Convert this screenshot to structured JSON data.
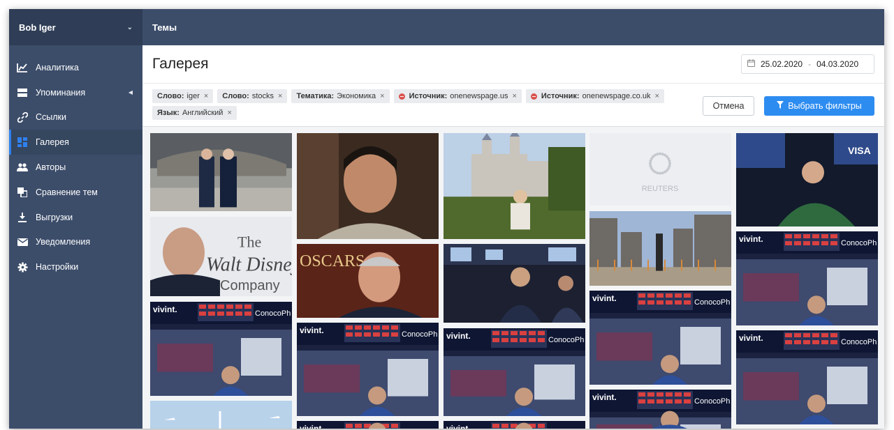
{
  "sidebar": {
    "user_name": "Bob Iger",
    "items": [
      {
        "label": "Аналитика",
        "icon": "chart-icon"
      },
      {
        "label": "Упоминания",
        "icon": "mentions-icon"
      },
      {
        "label": "Ссылки",
        "icon": "link-icon"
      },
      {
        "label": "Галерея",
        "icon": "gallery-icon"
      },
      {
        "label": "Авторы",
        "icon": "authors-icon"
      },
      {
        "label": "Сравнение тем",
        "icon": "compare-icon"
      },
      {
        "label": "Выгрузки",
        "icon": "download-icon"
      },
      {
        "label": "Уведомления",
        "icon": "mail-icon"
      },
      {
        "label": "Настройки",
        "icon": "gear-icon"
      }
    ],
    "active_index": 3
  },
  "topbar": {
    "title": "Темы"
  },
  "header": {
    "title": "Галерея",
    "date_from": "25.02.2020",
    "date_sep": "-",
    "date_to": "04.03.2020"
  },
  "filters": {
    "chips": [
      {
        "key": "Слово:",
        "value": "iger",
        "excluded": false
      },
      {
        "key": "Слово:",
        "value": "stocks",
        "excluded": false
      },
      {
        "key": "Тематика:",
        "value": "Экономика",
        "excluded": false
      },
      {
        "key": "Источник:",
        "value": "onenewspage.us",
        "excluded": true
      },
      {
        "key": "Источник:",
        "value": "onenewspage.co.uk",
        "excluded": true
      },
      {
        "key": "Язык:",
        "value": "Английский",
        "excluded": false
      }
    ],
    "close_glyph": "×",
    "cancel_label": "Отмена",
    "apply_label": "Выбрать фильтры"
  },
  "gallery": {
    "reuters_label": "REUTERS",
    "tiles": [
      {
        "subject": "studio-visit"
      },
      {
        "subject": "disney-portrait"
      },
      {
        "subject": "stock-exchange-screens"
      },
      {
        "subject": "airshow"
      },
      {
        "subject": "actor-portrait"
      },
      {
        "subject": "oscars-portrait"
      },
      {
        "subject": "stock-exchange-screens"
      },
      {
        "subject": "stock-exchange-screens"
      },
      {
        "subject": "castle-park"
      },
      {
        "subject": "traders-floor"
      },
      {
        "subject": "stock-exchange-screens"
      },
      {
        "subject": "stock-exchange-screens"
      },
      {
        "subject": "reuters-placeholder"
      },
      {
        "subject": "city-plaza"
      },
      {
        "subject": "stock-exchange-screens"
      },
      {
        "subject": "stock-exchange-screens"
      },
      {
        "subject": "trader-visa"
      },
      {
        "subject": "stock-exchange-screens"
      },
      {
        "subject": "stock-exchange-screens"
      }
    ]
  },
  "colors": {
    "sidebar_bg": "#3c4d6a",
    "accent": "#2d8cf0",
    "excluded_badge": "#d9534f"
  }
}
